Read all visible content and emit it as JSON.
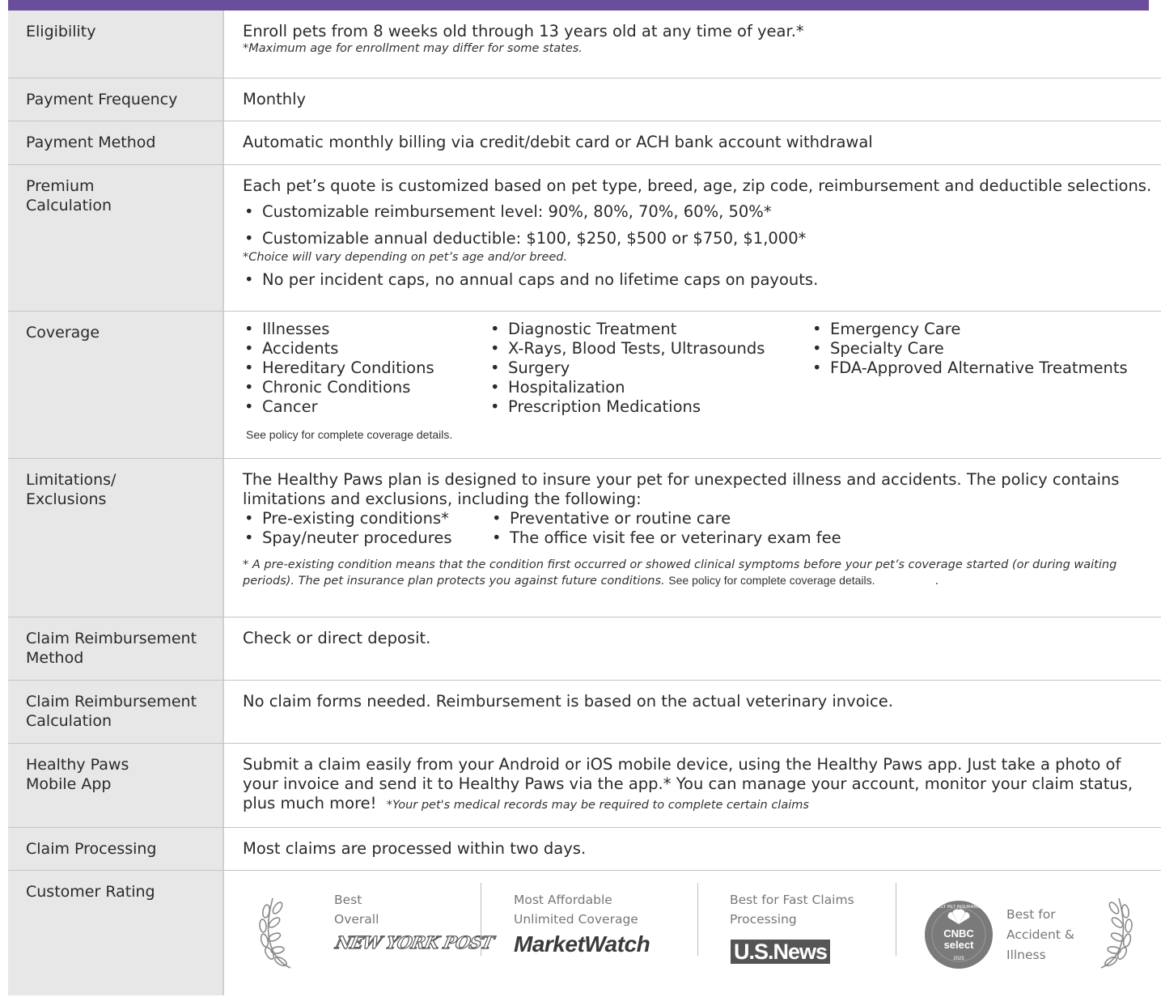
{
  "rows": {
    "eligibility": {
      "label": "Eligibility",
      "text": "Enroll pets from 8 weeks old through 13 years old at any time of year.*",
      "note": "*Maximum age for enrollment may differ for some states."
    },
    "payment_frequency": {
      "label": "Payment Frequency",
      "text": "Monthly"
    },
    "payment_method": {
      "label": "Payment Method",
      "text": "Automatic monthly billing via credit/debit card or ACH bank account withdrawal"
    },
    "premium": {
      "label": "Premium\nCalculation",
      "text": "Each pet’s quote is customized based on pet type, breed, age, zip code, reimbursement and deductible selections.",
      "bullets": [
        "Customizable reimbursement level: 90%, 80%, 70%, 60%, 50%*",
        "Customizable annual deductible: $100, $250, $500 or $750, $1,000*"
      ],
      "note": "*Choice will vary depending on pet’s age and/or breed.",
      "bullet_last": "No per incident caps, no annual caps and no lifetime caps on payouts."
    },
    "coverage": {
      "label": "Coverage",
      "col1": [
        "Illnesses",
        "Accidents",
        "Hereditary Conditions",
        "Chronic Conditions",
        "Cancer"
      ],
      "col2": [
        "Diagnostic Treatment",
        "X-Rays, Blood Tests, Ultrasounds",
        "Surgery",
        "Hospitalization",
        "Prescription Medications"
      ],
      "col3": [
        "Emergency Care",
        "Specialty Care",
        "FDA-Approved Alternative Treatments"
      ],
      "see_policy": "See policy for complete coverage details."
    },
    "limitations": {
      "label": "Limitations/\nExclusions",
      "text": "The Healthy Paws plan is designed to insure your pet for unexpected illness and accidents. The policy contains limitations and exclusions, including the following:",
      "col1": [
        "Pre-existing conditions*",
        "Spay/neuter procedures"
      ],
      "col2": [
        "Preventative or routine care",
        "The office visit fee or veterinary exam fee"
      ],
      "note": "* A pre-existing condition means that the condition first occurred or showed clinical symptoms before your pet’s coverage started (or during waiting periods). The pet insurance plan protects you against future conditions.",
      "see_policy": "See policy for complete coverage details.",
      "trailing": "."
    },
    "claim_method": {
      "label": "Claim Reimbursement\nMethod",
      "text": "Check or direct deposit."
    },
    "claim_calc": {
      "label": "Claim Reimbursement\nCalculation",
      "text": "No claim forms needed. Reimbursement is based on the actual veterinary invoice."
    },
    "mobile_app": {
      "label": "Healthy Paws\nMobile App",
      "text": "Submit a claim easily from your Android or iOS mobile device, using the Healthy Paws app. Just take a photo of your invoice and send it to Healthy Paws via the app.*   You can manage your account, monitor your claim status, plus much more!",
      "note": "*Your pet's medical records may be required to complete certain claims"
    },
    "claim_processing": {
      "label": "Claim Processing",
      "text": "Most claims are processed within two days."
    },
    "customer_rating": {
      "label": "Customer Rating",
      "awards": [
        {
          "text": "Best\nOverall",
          "logo": "NEW YORK POST"
        },
        {
          "text": "Most Affordable\nUnlimited Coverage",
          "logo": "MarketWatch"
        },
        {
          "text": "Best for Fast Claims\nProcessing",
          "logo": "U.S.News"
        },
        {
          "text": "Best for\nAccident &\nIllness",
          "badge_top": "BEST PET INSURANCE",
          "badge_main": "CNBC",
          "badge_sub": "select",
          "badge_year": "2025"
        }
      ]
    }
  },
  "colors": {
    "accent": "#6b4e9b",
    "label_bg": "#e7e7e7"
  }
}
